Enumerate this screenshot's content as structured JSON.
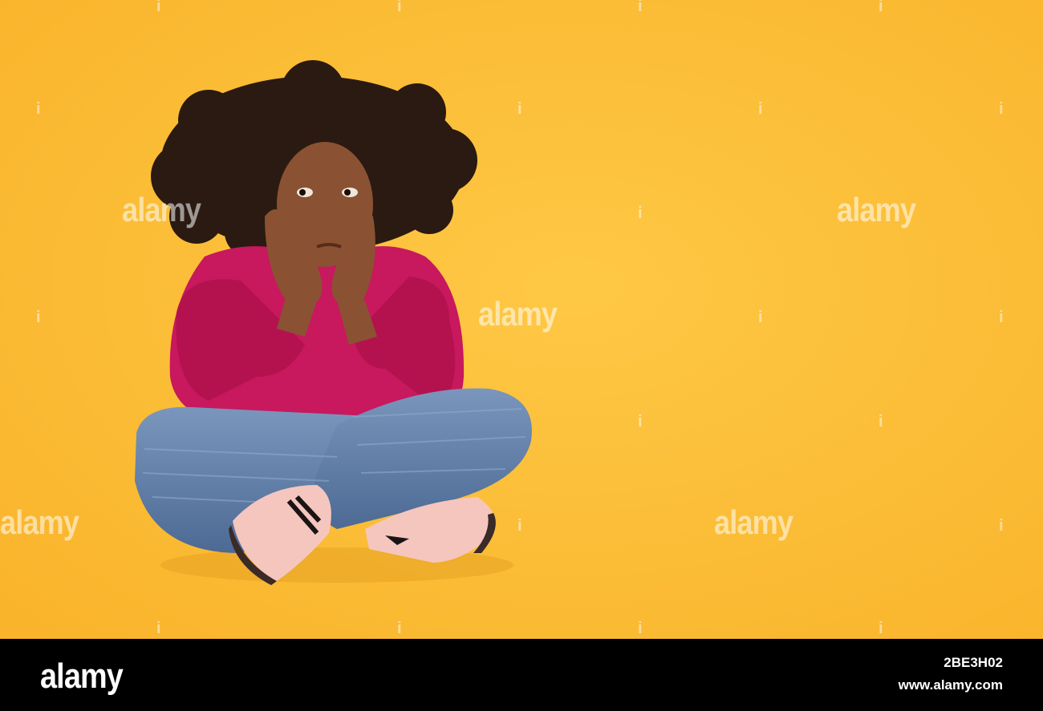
{
  "watermark": {
    "text": "alamy",
    "marker": "i"
  },
  "footer": {
    "logo": "alamy",
    "image_id": "2BE3H02",
    "url": "www.alamy.com"
  },
  "colors": {
    "background": "#FDBE3A",
    "sweater": "#C8185E",
    "jeans": "#5F7FA8",
    "shoes": "#F5C6BE"
  }
}
